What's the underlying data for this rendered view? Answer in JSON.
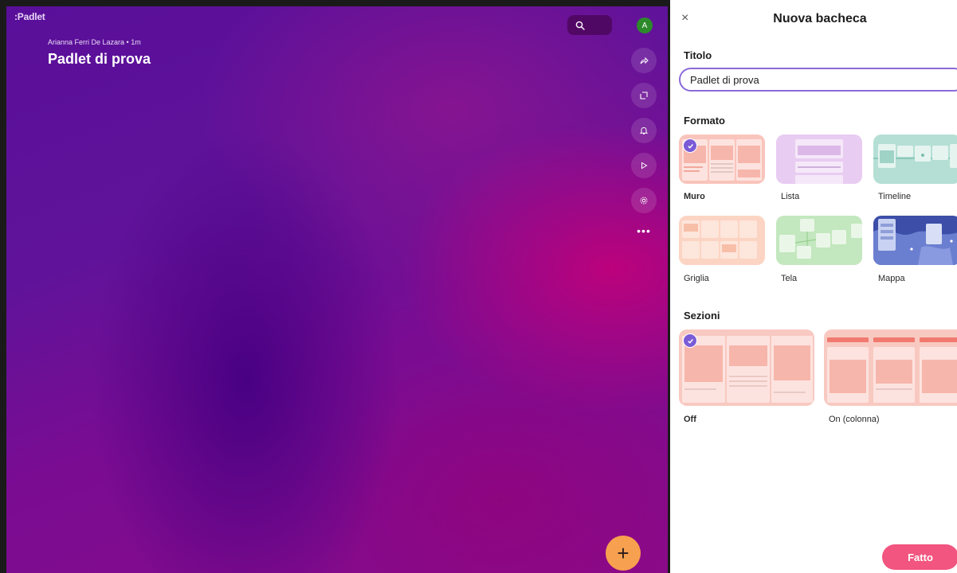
{
  "board": {
    "logo": ":Padlet",
    "author_line": "Arianna Ferri De Lazara • 1m",
    "title": "Padlet di prova",
    "avatar_letter": "A",
    "more_label": "•••",
    "fab_label": "+"
  },
  "panel": {
    "close_label": "×",
    "title": "Nuova bacheca",
    "titolo_label": "Titolo",
    "titolo_value": "Padlet di prova",
    "formato_label": "Formato",
    "formats": [
      {
        "label": "Muro",
        "selected": true
      },
      {
        "label": "Lista",
        "selected": false
      },
      {
        "label": "Timeline",
        "selected": false
      },
      {
        "label": "Griglia",
        "selected": false
      },
      {
        "label": "Tela",
        "selected": false
      },
      {
        "label": "Mappa",
        "selected": false
      }
    ],
    "sezioni_label": "Sezioni",
    "sections": [
      {
        "label": "Off",
        "selected": true
      },
      {
        "label": "On (colonna)",
        "selected": false
      }
    ],
    "done_label": "Fatto"
  },
  "colors": {
    "accent_purple": "#7b5cd6",
    "done_pink": "#f2557f",
    "fab_orange": "#f7a04f",
    "avatar_green": "#2c8a2a"
  }
}
